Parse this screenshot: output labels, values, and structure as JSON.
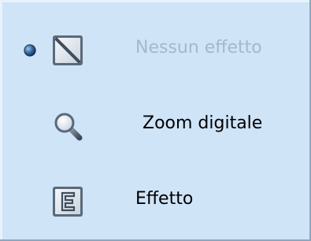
{
  "effect_menu": {
    "items": [
      {
        "label": "Nessun effetto",
        "icon": "no-effect-icon",
        "selected": true,
        "disabled": true
      },
      {
        "label": "Zoom digitale",
        "icon": "magnifier-icon",
        "selected": false,
        "disabled": false
      },
      {
        "label": "Effetto",
        "icon": "effect-icon",
        "selected": false,
        "disabled": false
      }
    ]
  },
  "colors": {
    "background": "#cfe4f7",
    "disabled_text": "#a7b8c8",
    "indicator": "#2c5a8c"
  }
}
